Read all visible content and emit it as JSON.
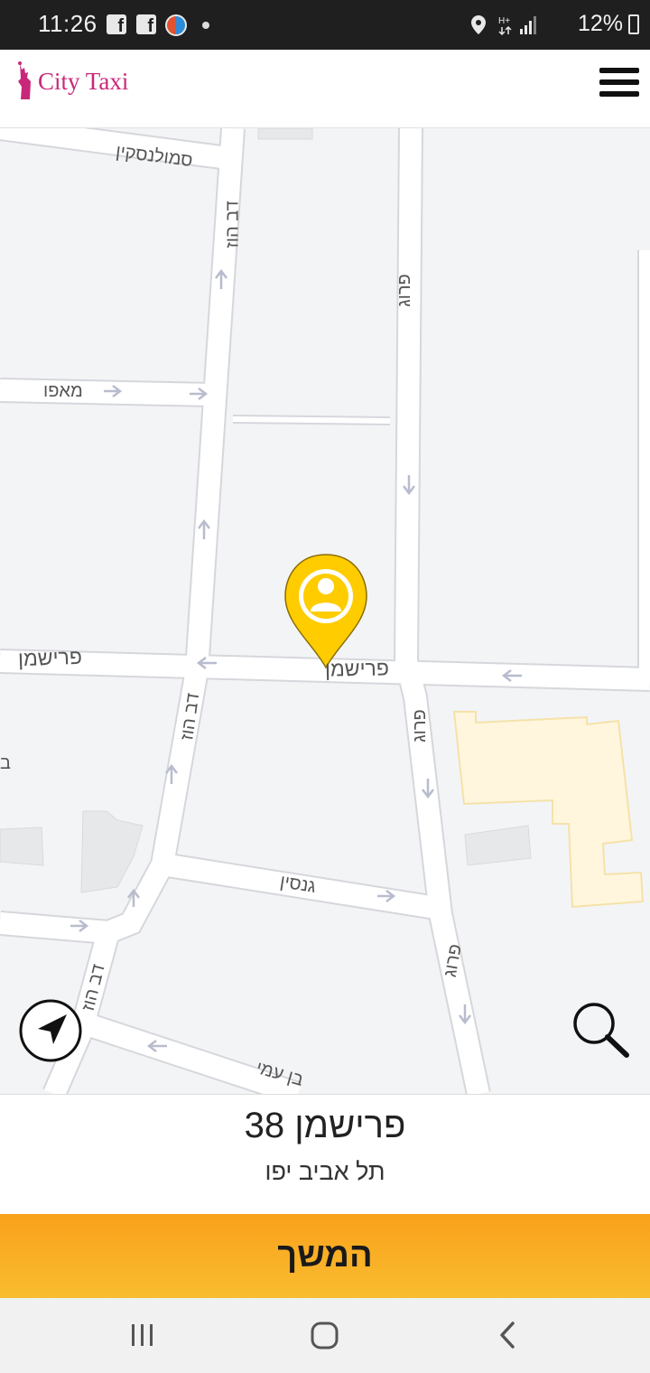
{
  "status_bar": {
    "time": "11:26",
    "battery_percent": "12%",
    "icons": [
      "facebook-icon",
      "facebook-icon",
      "app-icon",
      "notification-dot",
      "location-icon",
      "data-arrows-icon",
      "signal-icon",
      "battery-charging-icon"
    ]
  },
  "header": {
    "logo_text": "City Taxi",
    "logo_color": "#c8287a",
    "menu_icon": "hamburger-menu-icon"
  },
  "map": {
    "streets": {
      "smolenskin": "סמולנסקין",
      "mapu": "מאפו",
      "dov_hoz_1": "דב הוז",
      "dov_hoz_2": "דב הוז",
      "dov_hoz_3": "דב הוז",
      "frug_1": "פרוג",
      "frug_2": "פרוג",
      "frug_3": "פרוג",
      "frishman_left": "פרישמן",
      "frishman_center": "פרישמן",
      "gnessin": "גנסין",
      "ben_ami": "בן עמי",
      "edge_partial": "ב"
    },
    "pin_color": "#ffcc00",
    "pin_icon": "user-location-pin-icon"
  },
  "controls": {
    "locate_icon": "navigation-arrow-icon",
    "search_icon": "search-icon"
  },
  "address": {
    "street_line": "פרישמן 38",
    "city_line": "תל אביב יפו"
  },
  "action": {
    "continue_label": "המשך",
    "color": "#f9a11b"
  },
  "system_nav": {
    "icons": [
      "recent-apps-icon",
      "home-icon",
      "back-icon"
    ]
  }
}
